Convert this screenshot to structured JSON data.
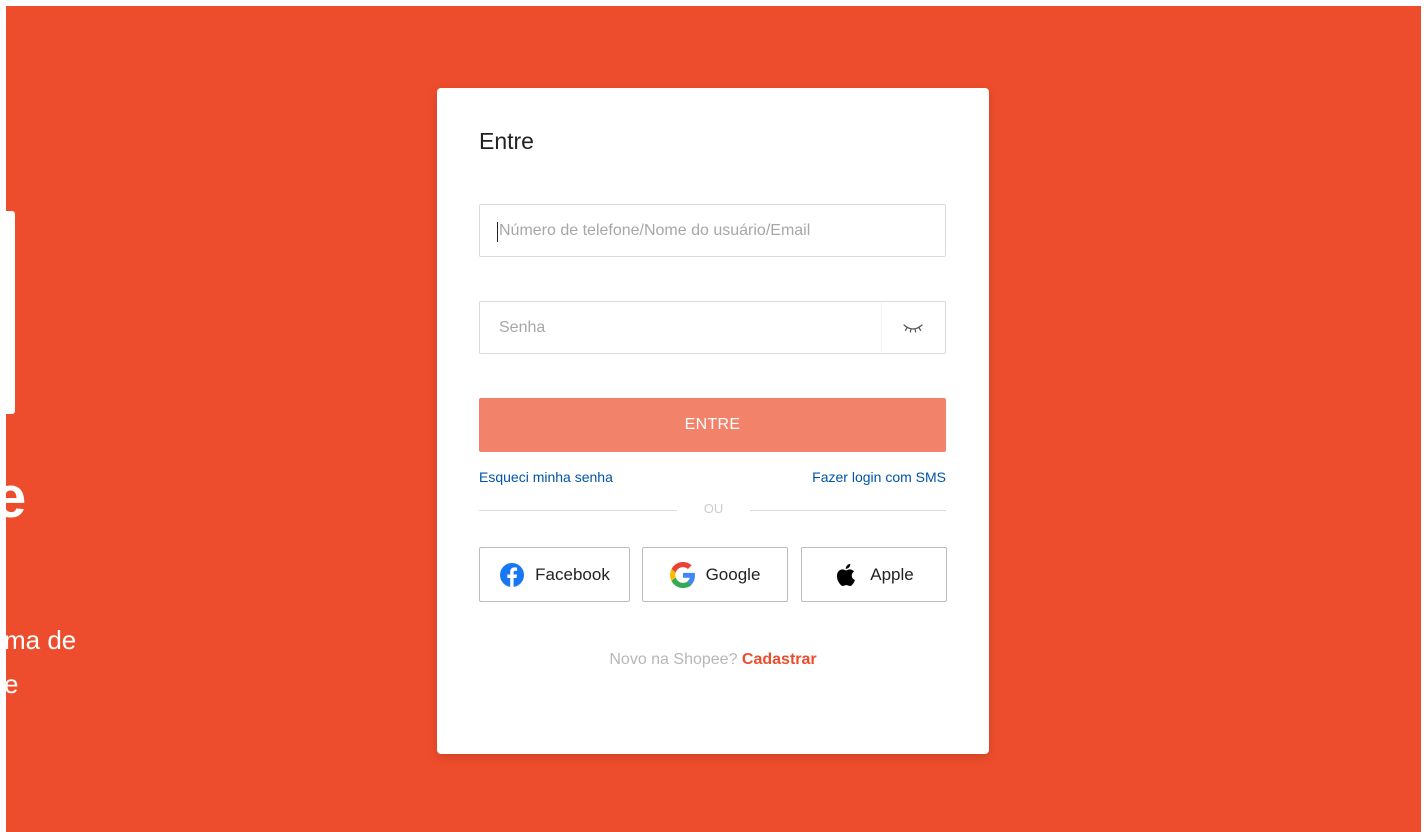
{
  "colors": {
    "brand": "#ee4d2d",
    "button_disabled": "#f3826b",
    "link": "#0055aa",
    "muted_text": "#b7b7b7"
  },
  "background": {
    "brand_partial_letter": "e",
    "tagline_partial": "ma de\ne"
  },
  "login": {
    "title": "Entre",
    "username_placeholder": "Número de telefone/Nome do usuário/Email",
    "password_placeholder": "Senha",
    "password_toggle_icon": "eye-closed-icon",
    "submit_label": "ENTRE",
    "forgot_password_label": "Esqueci minha senha",
    "sms_login_label": "Fazer login com SMS",
    "divider_label": "OU",
    "social": {
      "facebook_label": "Facebook",
      "google_label": "Google",
      "apple_label": "Apple"
    },
    "signup_prompt": "Novo na Shopee?",
    "signup_link": "Cadastrar"
  }
}
